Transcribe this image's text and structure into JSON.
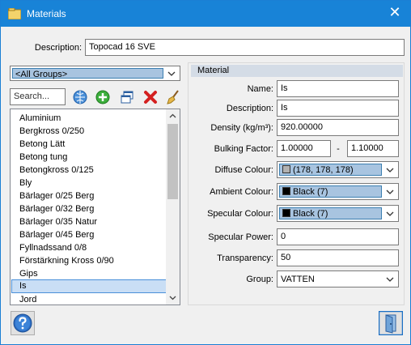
{
  "window": {
    "title": "Materials",
    "close_glyph": "✕"
  },
  "description": {
    "label": "Description:",
    "value": "Topocad 16 SVE"
  },
  "group_filter": {
    "value": "<All Groups>"
  },
  "search": {
    "placeholder": "Search..."
  },
  "toolbar": {
    "buttons": [
      "globe-icon",
      "add-icon",
      "windows-icon",
      "delete-icon",
      "broom-icon"
    ]
  },
  "material_list": {
    "items": [
      "Aluminium",
      "Bergkross 0/250",
      "Betong Lätt",
      "Betong tung",
      "Betongkross 0/125",
      "Bly",
      "Bärlager 0/25 Berg",
      "Bärlager 0/32 Berg",
      "Bärlager 0/35 Natur",
      "Bärlager 0/45 Berg",
      "Fyllnadssand 0/8",
      "Förstärkning Kross 0/90",
      "Gips",
      "Is",
      "Jord"
    ],
    "selected": "Is"
  },
  "material": {
    "header": "Material",
    "name_label": "Name:",
    "name_value": "Is",
    "description_label": "Description:",
    "description_value": "Is",
    "density_label": "Density (kg/m³):",
    "density_value": "920.00000",
    "bulking_label": "Bulking Factor:",
    "bulking_from": "1.00000",
    "bulking_dash": "-",
    "bulking_to": "1.10000",
    "diffuse_label": "Diffuse Colour:",
    "diffuse_value": "(178, 178, 178)",
    "diffuse_color": "#b2b2b2",
    "ambient_label": "Ambient Colour:",
    "ambient_value": "Black (7)",
    "ambient_color": "#000000",
    "specular_label": "Specular Colour:",
    "specular_value": "Black (7)",
    "specular_color": "#000000",
    "specular_power_label": "Specular Power:",
    "specular_power_value": "0",
    "transparency_label": "Transparency:",
    "transparency_value": "50",
    "group_label": "Group:",
    "group_value": "VATTEN"
  },
  "colors": {
    "titlebar": "#1883d7",
    "selection": "#c9def5"
  }
}
